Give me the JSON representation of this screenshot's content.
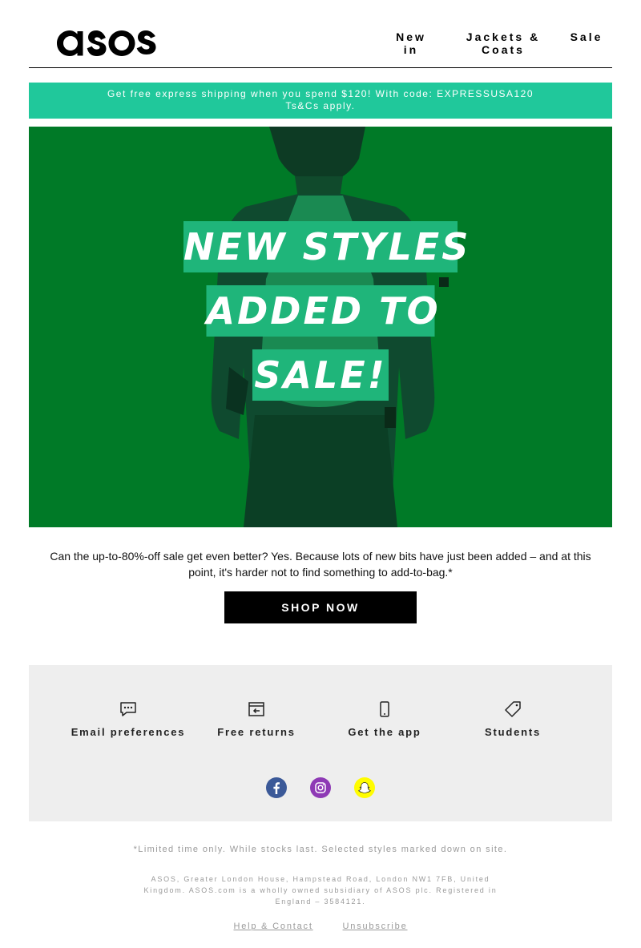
{
  "brand": {
    "logo_text": "asos"
  },
  "nav": [
    {
      "label": "New in"
    },
    {
      "label": "Jackets & Coats"
    },
    {
      "label": "Sale"
    }
  ],
  "promo": {
    "line1": "Get free express shipping when you spend $120! With code: EXPRESSUSA120",
    "line2": "Ts&Cs apply."
  },
  "hero": {
    "headline_lines": [
      "NEW STYLES",
      "ADDED TO",
      "SALE!"
    ],
    "colors": {
      "background": "#007a27",
      "highlight": "#1fb57a"
    }
  },
  "body": {
    "copy": "Can the up-to-80%-off sale get even better? Yes. Because lots of new bits have just been added – and at this point, it's harder not to find something to add-to-bag.*",
    "cta_label": "SHOP NOW"
  },
  "features": [
    {
      "label": "Email preferences",
      "icon": "chat-bubble-icon"
    },
    {
      "label": "Free returns",
      "icon": "return-box-icon"
    },
    {
      "label": "Get the app",
      "icon": "phone-icon"
    },
    {
      "label": "Students",
      "icon": "tag-icon"
    }
  ],
  "social": [
    {
      "name": "facebook",
      "color": "#3b5998"
    },
    {
      "name": "instagram",
      "color": "#8e3ab5"
    },
    {
      "name": "snapchat",
      "color": "#fffc00"
    }
  ],
  "footer": {
    "disclaimer": "*Limited time only. While stocks last. Selected styles marked down on site.",
    "address": "ASOS, Greater London House, Hampstead Road, London NW1 7FB, United Kingdom. ASOS.com is a wholly owned subsidiary of ASOS plc. Registered in England – 3584121.",
    "links": [
      "Help & Contact",
      "Unsubscribe"
    ]
  }
}
